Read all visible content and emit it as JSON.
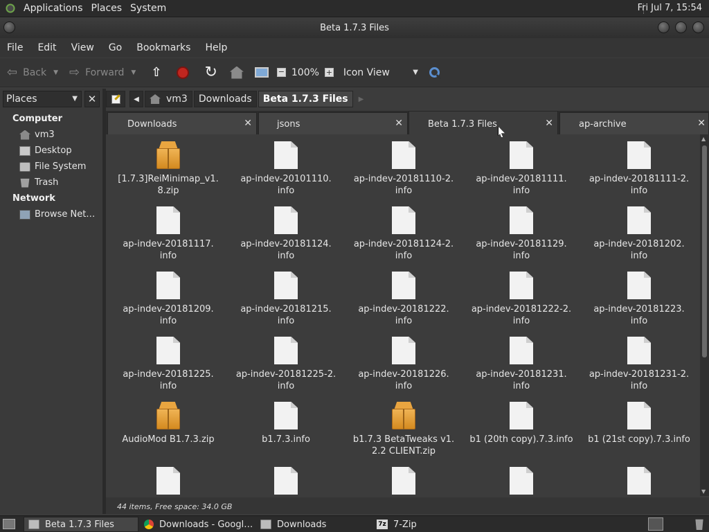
{
  "top_panel": {
    "menu": [
      "Applications",
      "Places",
      "System"
    ],
    "clock": "Fri Jul  7, 15:54"
  },
  "window": {
    "title": "Beta 1.7.3 Files"
  },
  "menubar": [
    "File",
    "Edit",
    "View",
    "Go",
    "Bookmarks",
    "Help"
  ],
  "toolbar": {
    "back": "Back",
    "forward": "Forward",
    "zoom": "100%",
    "view_mode": "Icon View"
  },
  "sidebar": {
    "selector": "Places",
    "categories": [
      {
        "label": "Computer",
        "items": [
          "vm3",
          "Desktop",
          "File System",
          "Trash"
        ]
      },
      {
        "label": "Network",
        "items": [
          "Browse Net…"
        ]
      }
    ]
  },
  "breadcrumb": [
    "vm3",
    "Downloads",
    "Beta 1.7.3 Files"
  ],
  "tabs": [
    {
      "label": "Downloads"
    },
    {
      "label": "jsons"
    },
    {
      "label": "Beta 1.7.3 Files",
      "active": true
    },
    {
      "label": "ap-archive"
    }
  ],
  "files": [
    {
      "name": "[1.7.3]ReiMinimap_v1.8.zip",
      "line1": "[1.7.3]ReiMinimap_v1.",
      "line2": "8.zip",
      "icon": "package"
    },
    {
      "name": "ap-indev-20101110.info",
      "line1": "ap-indev-20101110.",
      "line2": "info",
      "icon": "document"
    },
    {
      "name": "ap-indev-20181110-2.info",
      "line1": "ap-indev-20181110-2.",
      "line2": "info",
      "icon": "document"
    },
    {
      "name": "ap-indev-20181111.info",
      "line1": "ap-indev-20181111.",
      "line2": "info",
      "icon": "document"
    },
    {
      "name": "ap-indev-20181111-2.info",
      "line1": "ap-indev-20181111-2.",
      "line2": "info",
      "icon": "document"
    },
    {
      "name": "ap-indev-20181117.info",
      "line1": "ap-indev-20181117.",
      "line2": "info",
      "icon": "document"
    },
    {
      "name": "ap-indev-20181124.info",
      "line1": "ap-indev-20181124.",
      "line2": "info",
      "icon": "document"
    },
    {
      "name": "ap-indev-20181124-2.info",
      "line1": "ap-indev-20181124-2.",
      "line2": "info",
      "icon": "document"
    },
    {
      "name": "ap-indev-20181129.info",
      "line1": "ap-indev-20181129.",
      "line2": "info",
      "icon": "document"
    },
    {
      "name": "ap-indev-20181202.info",
      "line1": "ap-indev-20181202.",
      "line2": "info",
      "icon": "document"
    },
    {
      "name": "ap-indev-20181209.info",
      "line1": "ap-indev-20181209.",
      "line2": "info",
      "icon": "document"
    },
    {
      "name": "ap-indev-20181215.info",
      "line1": "ap-indev-20181215.",
      "line2": "info",
      "icon": "document"
    },
    {
      "name": "ap-indev-20181222.info",
      "line1": "ap-indev-20181222.",
      "line2": "info",
      "icon": "document"
    },
    {
      "name": "ap-indev-20181222-2.info",
      "line1": "ap-indev-20181222-2.",
      "line2": "info",
      "icon": "document"
    },
    {
      "name": "ap-indev-20181223.info",
      "line1": "ap-indev-20181223.",
      "line2": "info",
      "icon": "document"
    },
    {
      "name": "ap-indev-20181225.info",
      "line1": "ap-indev-20181225.",
      "line2": "info",
      "icon": "document"
    },
    {
      "name": "ap-indev-20181225-2.info",
      "line1": "ap-indev-20181225-2.",
      "line2": "info",
      "icon": "document"
    },
    {
      "name": "ap-indev-20181226.info",
      "line1": "ap-indev-20181226.",
      "line2": "info",
      "icon": "document"
    },
    {
      "name": "ap-indev-20181231.info",
      "line1": "ap-indev-20181231.",
      "line2": "info",
      "icon": "document"
    },
    {
      "name": "ap-indev-20181231-2.info",
      "line1": "ap-indev-20181231-2.",
      "line2": "info",
      "icon": "document"
    },
    {
      "name": "AudioMod B1.7.3.zip",
      "line1": "AudioMod B1.7.3.zip",
      "line2": "",
      "icon": "package"
    },
    {
      "name": "b1.7.3.info",
      "line1": "b1.7.3.info",
      "line2": "",
      "icon": "document"
    },
    {
      "name": "b1.7.3 BetaTweaks v1.2.2 CLIENT.zip",
      "line1": "b1.7.3 BetaTweaks v1.",
      "line2": "2.2 CLIENT.zip",
      "icon": "package"
    },
    {
      "name": "b1 (20th copy).7.3.info",
      "line1": "b1 (20th copy).7.3.info",
      "line2": "",
      "icon": "document"
    },
    {
      "name": "b1 (21st copy).7.3.info",
      "line1": "b1 (21st copy).7.3.info",
      "line2": "",
      "icon": "document"
    },
    {
      "name": "",
      "line1": "",
      "line2": "",
      "icon": "document"
    },
    {
      "name": "",
      "line1": "",
      "line2": "",
      "icon": "document"
    },
    {
      "name": "",
      "line1": "",
      "line2": "",
      "icon": "document"
    },
    {
      "name": "",
      "line1": "",
      "line2": "",
      "icon": "document"
    },
    {
      "name": "",
      "line1": "",
      "line2": "",
      "icon": "document"
    }
  ],
  "status": "44 items, Free space: 34.0 GB",
  "taskbar": [
    {
      "label": "Beta 1.7.3 Files",
      "icon": "folder-icon",
      "active": true
    },
    {
      "label": "Downloads - Googl…",
      "icon": "chrome-icon",
      "active": false
    },
    {
      "label": "Downloads",
      "icon": "folder-icon",
      "active": false
    },
    {
      "label": "7-Zip",
      "icon": "7zip-icon",
      "active": false
    }
  ],
  "colors": {
    "background": "#3c3c3c",
    "panel": "#2b2b2b",
    "text": "#e6e6e6",
    "stop_red": "#c0261f",
    "package_orange": "#e9a540"
  }
}
